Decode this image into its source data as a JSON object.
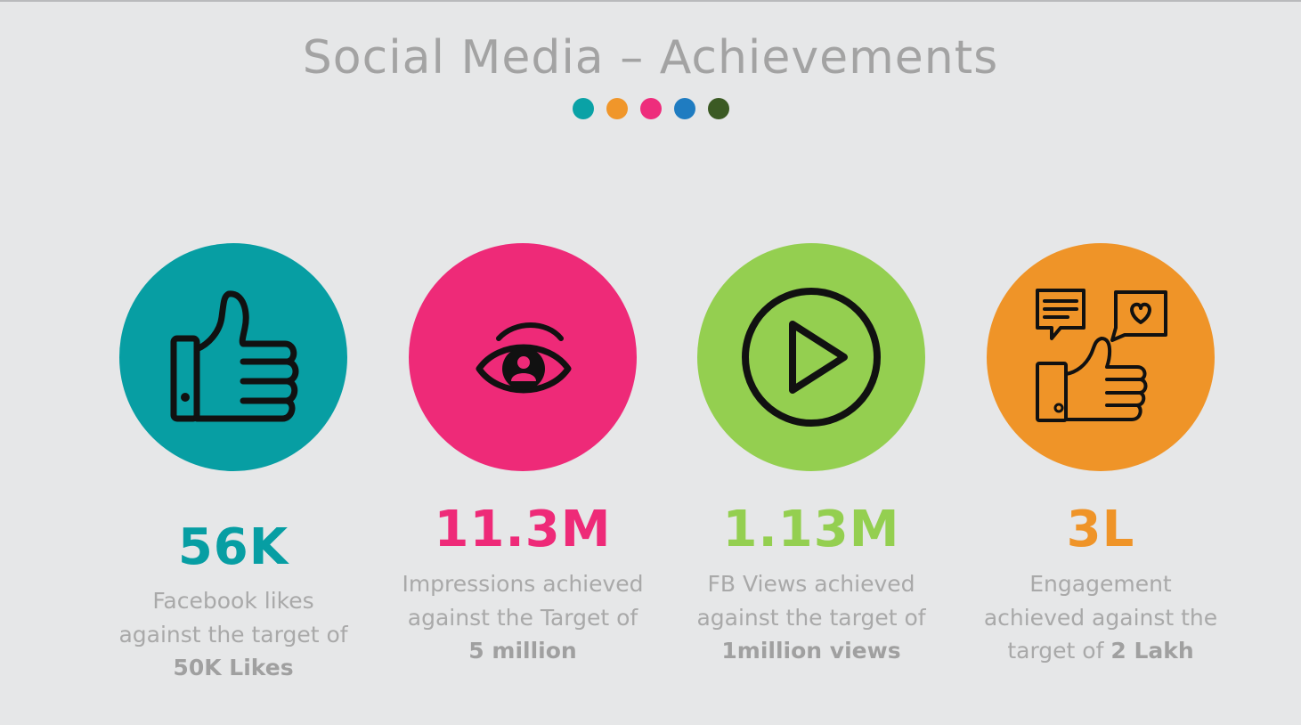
{
  "title": "Social Media – Achievements",
  "palette_dots": [
    "#0aa2a6",
    "#f0962a",
    "#ee2d7c",
    "#1f7cc1",
    "#3b5a23"
  ],
  "cards": [
    {
      "icon": "thumbs-up-icon",
      "color": "#079ea3",
      "value": "56K",
      "desc_line1": "Facebook likes",
      "desc_line2": "against the target of",
      "desc_prefix": "",
      "desc_bold": "50K Likes"
    },
    {
      "icon": "eye-icon",
      "color": "#ee2a78",
      "value": "11.3M",
      "desc_line1": "Impressions achieved",
      "desc_line2": "against the Target of",
      "desc_prefix": "",
      "desc_bold": "5 million"
    },
    {
      "icon": "play-icon",
      "color": "#94cf50",
      "value": "1.13M",
      "desc_line1": "FB Views achieved",
      "desc_line2": "against the target of",
      "desc_prefix": "",
      "desc_bold": "1million views"
    },
    {
      "icon": "engagement-icon",
      "color": "#ef9428",
      "value": "3L",
      "desc_line1": "Engagement",
      "desc_line2": "achieved against the",
      "desc_prefix": "target of ",
      "desc_bold": "2 Lakh"
    }
  ]
}
